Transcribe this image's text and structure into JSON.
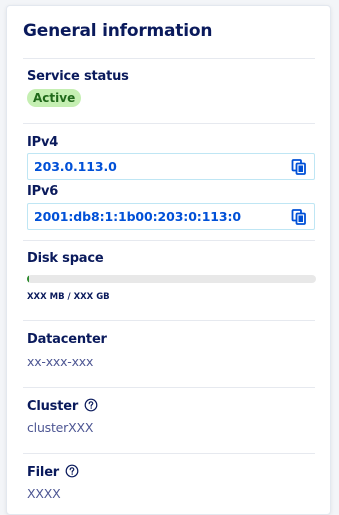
{
  "card": {
    "title": "General information"
  },
  "service_status": {
    "label": "Service status",
    "badge": "Active",
    "badge_color": "#c5efb2"
  },
  "ipv4": {
    "label": "IPv4",
    "value": "203.0.113.0",
    "copy_icon": "copy-icon"
  },
  "ipv6": {
    "label": "IPv6",
    "value": "2001:db8:1:1b00:203:0:113:0",
    "copy_icon": "copy-icon"
  },
  "disk_space": {
    "label": "Disk space",
    "usage_fraction": 0.005,
    "caption": "XXX MB / XXX GB"
  },
  "datacenter": {
    "label": "Datacenter",
    "value": "xx-xxx-xxx"
  },
  "cluster": {
    "label": "Cluster",
    "value": "clusterXXX",
    "help_icon": "help-circle-icon"
  },
  "filer": {
    "label": "Filer",
    "value": "XXXX",
    "help_icon": "help-circle-icon"
  }
}
